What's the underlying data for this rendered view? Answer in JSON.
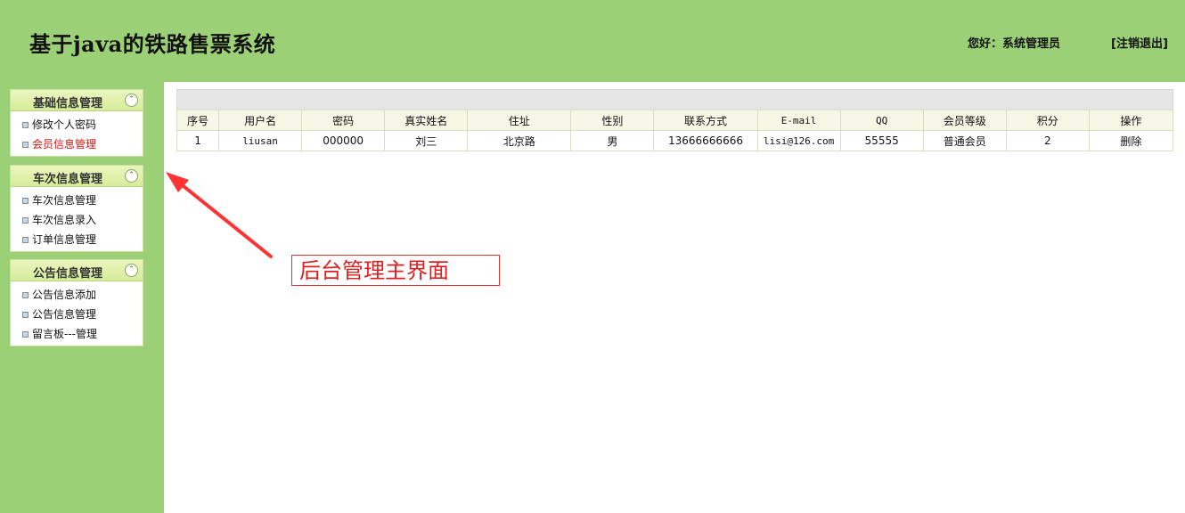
{
  "header": {
    "title": "基于java的铁路售票系统",
    "greeting": "您好：系统管理员",
    "logout_label": "[注销退出]"
  },
  "sidebar": {
    "panels": [
      {
        "title": "基础信息管理",
        "items": [
          {
            "label": "修改个人密码",
            "active": false
          },
          {
            "label": "会员信息管理",
            "active": true
          }
        ]
      },
      {
        "title": "车次信息管理",
        "items": [
          {
            "label": "车次信息管理",
            "active": false
          },
          {
            "label": "车次信息录入",
            "active": false
          },
          {
            "label": "订单信息管理",
            "active": false
          }
        ]
      },
      {
        "title": "公告信息管理",
        "items": [
          {
            "label": "公告信息添加",
            "active": false
          },
          {
            "label": "公告信息管理",
            "active": false
          },
          {
            "label": "留言板---管理",
            "active": false
          }
        ]
      }
    ],
    "collapse_icon": "chevron-up-circle-icon"
  },
  "table": {
    "columns": [
      "序号",
      "用户名",
      "密码",
      "真实姓名",
      "住址",
      "性别",
      "联系方式",
      "E-mail",
      "QQ",
      "会员等级",
      "积分",
      "操作"
    ],
    "rows": [
      [
        "1",
        "liusan",
        "000000",
        "刘三",
        "北京路",
        "男",
        "13666666666",
        "lisi@126.com",
        "55555",
        "普通会员",
        "2",
        "删除"
      ]
    ]
  },
  "annotation": {
    "text": "后台管理主界面",
    "color": "#e02020"
  },
  "colors": {
    "header_bg": "#9cd077",
    "sidebar_bg": "#9cd077",
    "active_item": "#d21616"
  }
}
